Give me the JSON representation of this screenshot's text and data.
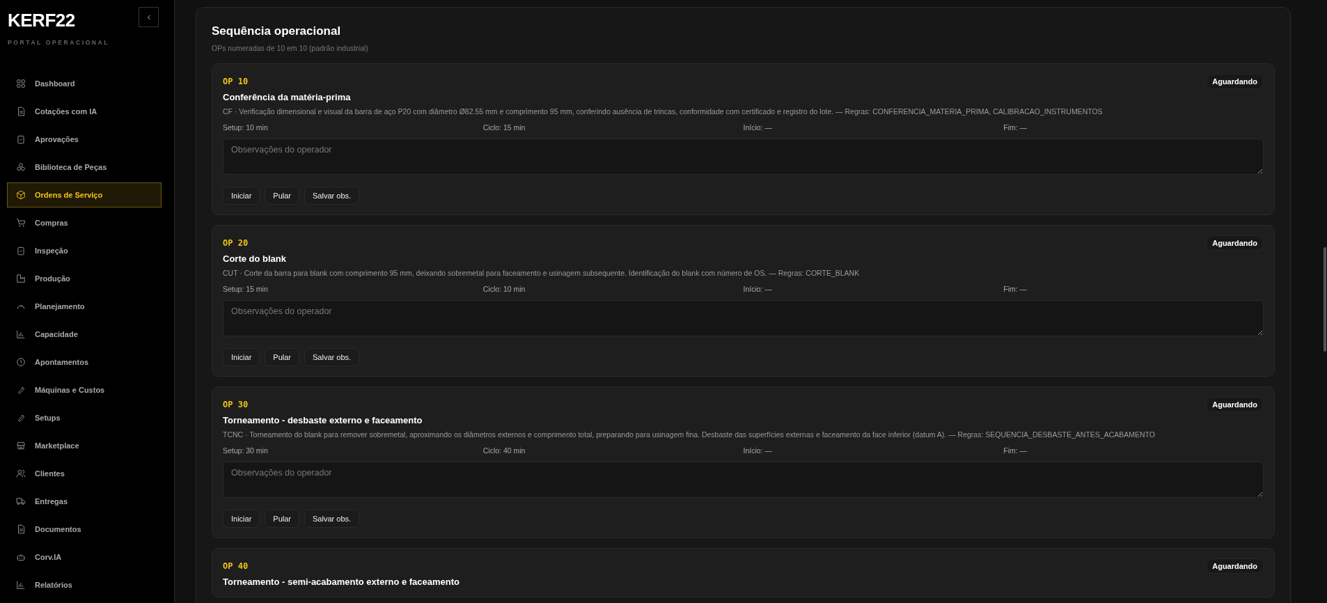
{
  "sidebar": {
    "logo": "KERF22",
    "subtitle": "PORTAL OPERACIONAL",
    "items": [
      {
        "label": "Dashboard",
        "selected": false
      },
      {
        "label": "Cotações com IA",
        "selected": false
      },
      {
        "label": "Aprovações",
        "selected": false
      },
      {
        "label": "Biblioteca de Peças",
        "selected": false
      },
      {
        "label": "Ordens de Serviço",
        "selected": true
      },
      {
        "label": "Compras",
        "selected": false
      },
      {
        "label": "Inspeção",
        "selected": false
      },
      {
        "label": "Produção",
        "selected": false
      },
      {
        "label": "Planejamento",
        "selected": false
      },
      {
        "label": "Capacidade",
        "selected": false
      },
      {
        "label": "Apontamentos",
        "selected": false
      },
      {
        "label": "Máquinas e Custos",
        "selected": false
      },
      {
        "label": "Setups",
        "selected": false
      },
      {
        "label": "Marketplace",
        "selected": false
      },
      {
        "label": "Clientes",
        "selected": false
      },
      {
        "label": "Entregas",
        "selected": false
      },
      {
        "label": "Documentos",
        "selected": false
      },
      {
        "label": "Corv.IA",
        "selected": false
      },
      {
        "label": "Relatórios",
        "selected": false
      }
    ]
  },
  "section": {
    "title": "Sequência operacional",
    "subtitle": "OPs numeradas de 10 em 10 (padrão industrial)",
    "operations": [
      {
        "code": "OP 10",
        "title": "Conferência da matéria-prima",
        "status": "Aguardando",
        "description": "CF · Verificação dimensional e visual da barra de aço P20 com diâmetro Ø82.55 mm e comprimento 95 mm, conferindo ausência de trincas, conformidade com certificado e registro do lote. — Regras: CONFERENCIA_MATERIA_PRIMA, CALIBRACAO_INSTRUMENTOS",
        "meta": [
          "Setup: 10 min",
          "Ciclo: 15 min",
          "Início: —",
          "Fim: —"
        ],
        "notes_placeholder": "Observações do operador",
        "buttons": [
          "Iniciar",
          "Pular",
          "Salvar obs."
        ]
      },
      {
        "code": "OP 20",
        "title": "Corte do blank",
        "status": "Aguardando",
        "description": "CUT · Corte da barra para blank com comprimento 95 mm, deixando sobremetal para faceamento e usinagem subsequente. Identificação do blank com número de OS. — Regras: CORTE_BLANK",
        "meta": [
          "Setup: 15 min",
          "Ciclo: 10 min",
          "Início: —",
          "Fim: —"
        ],
        "notes_placeholder": "Observações do operador",
        "buttons": [
          "Iniciar",
          "Pular",
          "Salvar obs."
        ]
      },
      {
        "code": "OP 30",
        "title": "Torneamento - desbaste externo e faceamento",
        "status": "Aguardando",
        "description": "TCNC · Torneamento do blank para remover sobremetal, aproximando os diâmetros externos e comprimento total, preparando para usinagem fina. Desbaste das superfícies externas e faceamento da face inferior (datum A). — Regras: SEQUENCIA_DESBASTE_ANTES_ACABAMENTO",
        "meta": [
          "Setup: 30 min",
          "Ciclo: 40 min",
          "Início: —",
          "Fim: —"
        ],
        "notes_placeholder": "Observações do operador",
        "buttons": [
          "Iniciar",
          "Pular",
          "Salvar obs."
        ]
      },
      {
        "code": "OP 40",
        "title": "Torneamento - semi-acabamento externo e faceamento",
        "status": "Aguardando"
      }
    ]
  }
}
